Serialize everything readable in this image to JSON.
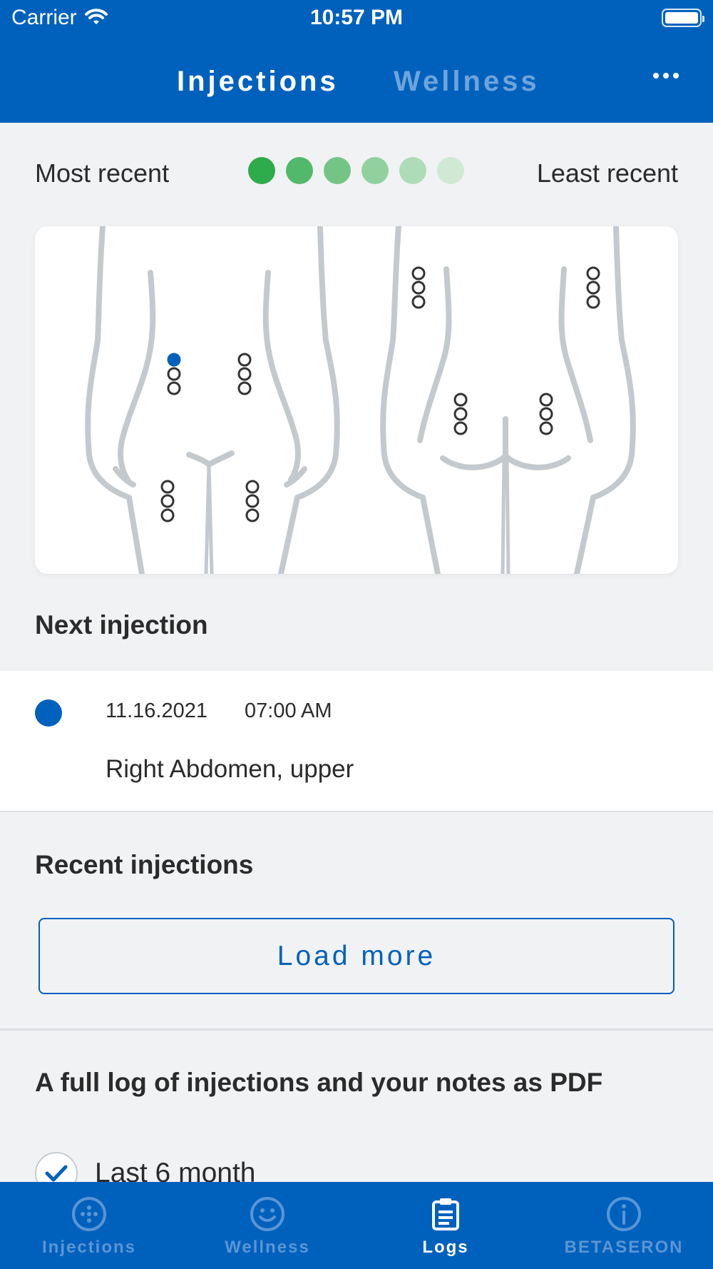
{
  "status_bar": {
    "carrier": "Carrier",
    "time": "10:57 PM"
  },
  "header": {
    "tabs": [
      {
        "label": "Injections",
        "active": true
      },
      {
        "label": "Wellness",
        "active": false
      }
    ],
    "more_icon": "more-horizontal-icon"
  },
  "legend": {
    "left_label": "Most recent",
    "right_label": "Least recent",
    "dot_colors": [
      "#2eab4a",
      "#52b96a",
      "#74c585",
      "#92d19f",
      "#aedcb7",
      "#cfe9d5"
    ]
  },
  "body_map": {
    "sites": [
      {
        "name": "Right Abdomen, upper",
        "filled_spots": 1,
        "total_spots": 3
      },
      {
        "name": "Left Abdomen, upper",
        "filled_spots": 0,
        "total_spots": 3
      },
      {
        "name": "Right Thigh",
        "filled_spots": 0,
        "total_spots": 3
      },
      {
        "name": "Left Thigh",
        "filled_spots": 0,
        "total_spots": 3
      },
      {
        "name": "Left Arm",
        "filled_spots": 0,
        "total_spots": 3
      },
      {
        "name": "Right Arm",
        "filled_spots": 0,
        "total_spots": 3
      },
      {
        "name": "Left Buttock",
        "filled_spots": 0,
        "total_spots": 3
      },
      {
        "name": "Right Buttock",
        "filled_spots": 0,
        "total_spots": 3
      }
    ],
    "highlight_color": "#0061bd"
  },
  "next_injection": {
    "title": "Next injection",
    "date": "11.16.2021",
    "time": "07:00 AM",
    "site": "Right Abdomen, upper"
  },
  "recent_injections": {
    "title": "Recent injections",
    "load_more_label": "Load more"
  },
  "pdf_log": {
    "title": "A full log of injections and your notes as PDF",
    "options": [
      {
        "label": "Last 6 month",
        "checked": true
      }
    ]
  },
  "tabbar": {
    "items": [
      {
        "label": "Injections",
        "icon": "injection-dots-icon",
        "active": false
      },
      {
        "label": "Wellness",
        "icon": "smiley-icon",
        "active": false
      },
      {
        "label": "Logs",
        "icon": "clipboard-icon",
        "active": true
      },
      {
        "label": "BETASERON",
        "icon": "info-icon",
        "active": false
      }
    ]
  },
  "colors": {
    "brand_blue": "#0061bd",
    "background": "#f1f2f4",
    "inactive_tab": "#5b95d4"
  }
}
